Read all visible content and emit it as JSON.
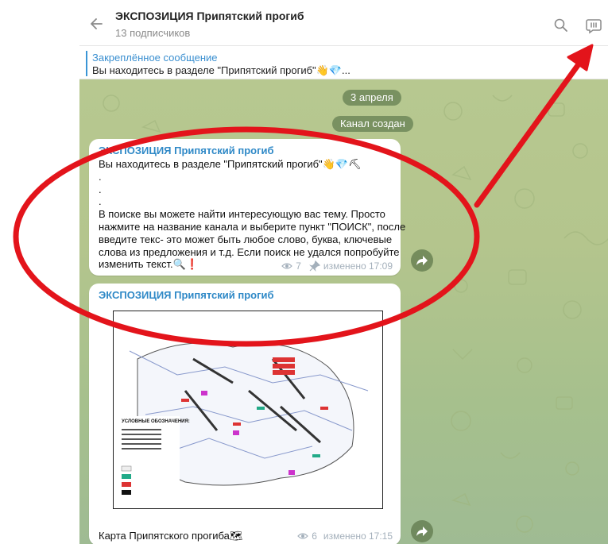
{
  "header": {
    "channel_title": "ЭКСПОЗИЦИЯ Припятский прогиб",
    "subscribers": "13 подписчиков"
  },
  "pinned": {
    "title": "Закреплённое сообщение",
    "text": "Вы находитесь в разделе \"Припятский прогиб\"👋💎..."
  },
  "service": {
    "date": "3 апреля",
    "created": "Канал создан"
  },
  "message1": {
    "sender": "ЭКСПОЗИЦИЯ Припятский прогиб",
    "lines": [
      "Вы находитесь в разделе \"Припятский прогиб\"👋💎⛏",
      ".",
      ".",
      ".",
      "В поиске вы можете найти интересующую вас тему. Просто",
      "нажмите на название канала и выберите пункт \"ПОИСК\", после",
      "введите текс- это может быть любое слово, буква, ключевые",
      "слова из предложения и т.д. Если поиск не удался попробуйте",
      "изменить текст.🔍❗"
    ],
    "views": "7",
    "edited": "изменено 17:09"
  },
  "message2": {
    "sender": "ЭКСПОЗИЦИЯ Припятский прогиб",
    "caption": "Карта Припятского прогиба🗺",
    "views": "6",
    "edited": "изменено 17:15",
    "map_legend": "УСЛОВНЫЕ ОБОЗНАЧЕНИЯ:"
  },
  "colors": {
    "accent": "#2f89c7",
    "annotation_red": "#e3141b"
  },
  "icons": [
    "back-arrow-icon",
    "search-icon",
    "discussion-icon",
    "eye-icon",
    "pin-icon",
    "forward-icon"
  ]
}
